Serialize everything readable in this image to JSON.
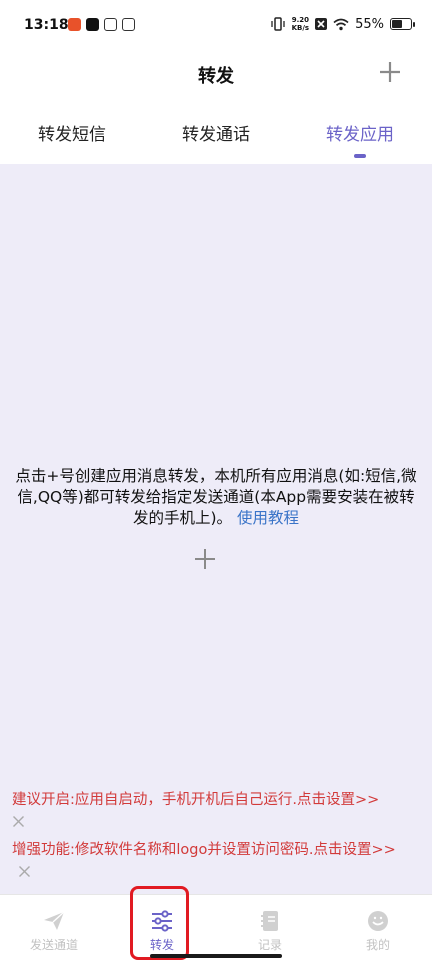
{
  "status_bar": {
    "time": "13:18",
    "net_speed_value": "9.20",
    "net_speed_unit": "KB/s",
    "battery_percent": "55%",
    "battery_level": 0.55
  },
  "header": {
    "title": "转发",
    "add_icon": "plus-icon"
  },
  "tabs": [
    {
      "label": "转发短信",
      "active": false
    },
    {
      "label": "转发通话",
      "active": false
    },
    {
      "label": "转发应用",
      "active": true
    }
  ],
  "main": {
    "empty_text": "点击+号创建应用消息转发，本机所有应用消息(如:短信,微信,QQ等)都可转发给指定发送通道(本App需要安装在被转发的手机上)。",
    "tutorial_link": "使用教程",
    "add_icon": "plus-icon"
  },
  "tips": [
    {
      "text": "建议开启:应用自启动，手机开机后自己运行.点击设置>>"
    },
    {
      "text": "增强功能:修改软件名称和logo并设置访问密码.点击设置>>"
    }
  ],
  "bottom_nav": [
    {
      "label": "发送通道",
      "icon": "send-icon",
      "active": false
    },
    {
      "label": "转发",
      "icon": "sliders-icon",
      "active": true
    },
    {
      "label": "记录",
      "icon": "notebook-icon",
      "active": false
    },
    {
      "label": "我的",
      "icon": "smile-icon",
      "active": false
    }
  ],
  "colors": {
    "accent": "#6b63c8",
    "content_bg": "#eeecf8",
    "tip_red": "#d23a3a",
    "link_blue": "#3a74c8",
    "highlight_red": "#e11a22",
    "inactive_gray": "#c2c2c2"
  }
}
